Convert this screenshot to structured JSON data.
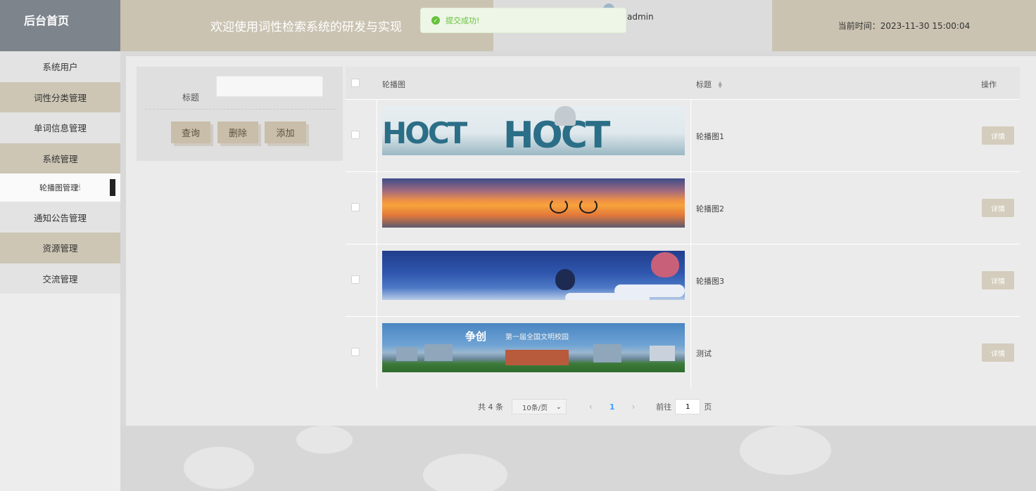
{
  "header": {
    "brand": "后台首页",
    "welcome": "欢迎使用词性检索系统的研发与实现",
    "username": "admin",
    "clock_label": "当前时间：",
    "clock_value": "2023-11-30 15:00:04"
  },
  "toast": {
    "message": "提交成功!",
    "icon": "check-circle-icon",
    "color": "#67c23a"
  },
  "sidebar": {
    "items": [
      {
        "label": "系统用户"
      },
      {
        "label": "词性分类管理"
      },
      {
        "label": "单词信息管理"
      },
      {
        "label": "系统管理"
      },
      {
        "label": "轮播图管理",
        "active": true
      },
      {
        "label": "通知公告管理"
      },
      {
        "label": "资源管理"
      },
      {
        "label": "交流管理"
      }
    ]
  },
  "search": {
    "title_label": "标题",
    "title_value": "",
    "query_button": "查询",
    "delete_button": "删除",
    "add_button": "添加"
  },
  "table": {
    "columns": {
      "image": "轮播图",
      "title": "标题",
      "actions": "操作"
    },
    "rows": [
      {
        "title": "轮播图1",
        "image_logo": "HOCT",
        "action": "详情"
      },
      {
        "title": "轮播图2",
        "action": "详情"
      },
      {
        "title": "轮播图3",
        "action": "详情"
      },
      {
        "title": "测试",
        "image_slogan": "争创",
        "image_slogan_sub": "第一届全国文明校园",
        "action": "详情"
      }
    ]
  },
  "pagination": {
    "total": "共 4 条",
    "page_size": "10条/页",
    "current_page": "1",
    "goto_label": "前往",
    "goto_value": "1",
    "goto_suffix": "页"
  },
  "colors": {
    "brand_bg": "#7d848c",
    "accent_tan": "#cbc3b2",
    "button_tan": "#c9bea9",
    "success": "#67c23a",
    "page_active": "#409eff"
  }
}
